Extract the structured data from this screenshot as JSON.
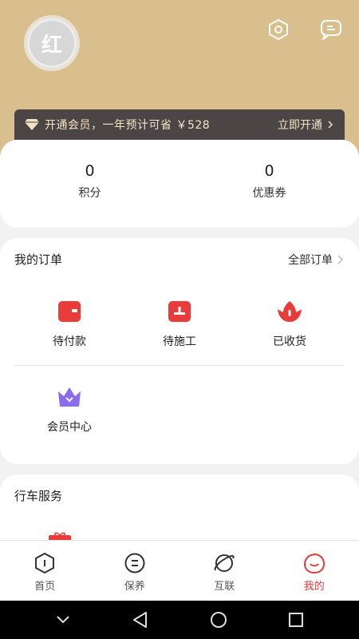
{
  "profile": {
    "avatar_char": "红"
  },
  "vip": {
    "text": "开通会员，一年预计可省 ￥528",
    "action": "立即开通"
  },
  "stats": [
    {
      "value": "0",
      "label": "积分"
    },
    {
      "value": "0",
      "label": "优惠券"
    }
  ],
  "orders": {
    "title": "我的订单",
    "all_label": "全部订单",
    "items": [
      {
        "label": "待付款",
        "icon": "wallet-icon"
      },
      {
        "label": "待施工",
        "icon": "toolbox-icon"
      },
      {
        "label": "已收货",
        "icon": "lotus-icon"
      },
      {
        "label": "会员中心",
        "icon": "crown-icon"
      }
    ]
  },
  "services": {
    "title": "行车服务"
  },
  "tabs": [
    {
      "label": "首页",
      "icon": "home-icon",
      "active": false
    },
    {
      "label": "保养",
      "icon": "maintenance-icon",
      "active": false
    },
    {
      "label": "互联",
      "icon": "planet-icon",
      "active": false
    },
    {
      "label": "我的",
      "icon": "profile-icon",
      "active": true
    }
  ],
  "colors": {
    "header": "#d9bf8e",
    "vip_bar": "#4c4545",
    "accent_red": "#e53a3a",
    "member_purple": "#8b6cf0"
  }
}
